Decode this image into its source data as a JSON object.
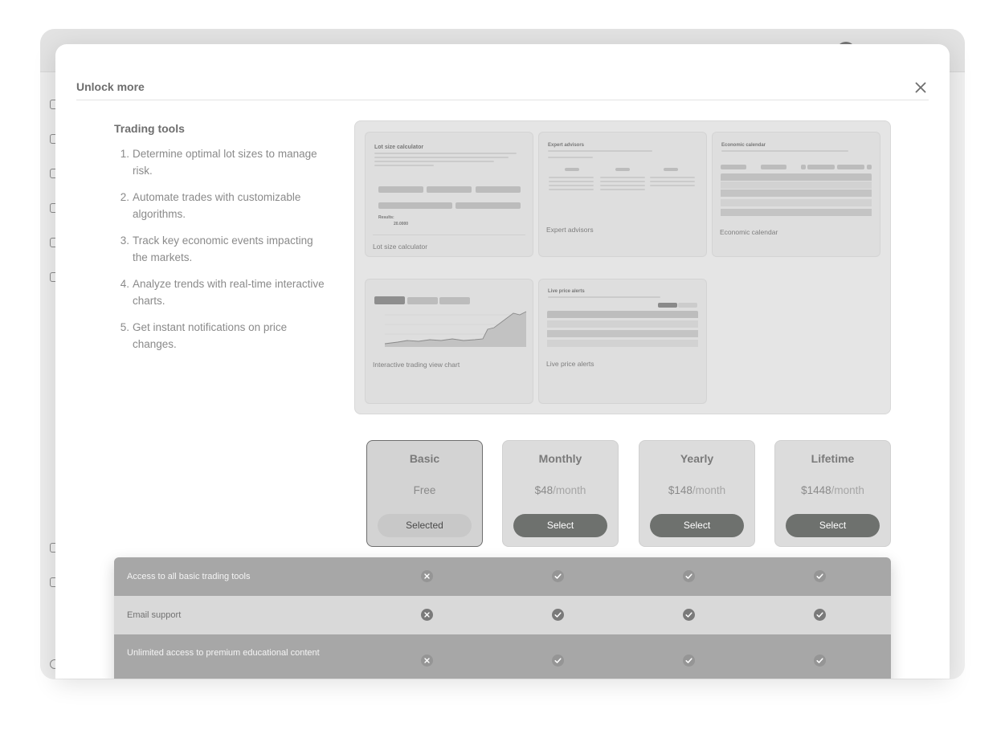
{
  "modal": {
    "title": "Unlock more"
  },
  "tools": {
    "heading": "Trading tools",
    "features": [
      {
        "num": "1.",
        "text": "Determine optimal lot sizes to manage risk."
      },
      {
        "num": "2.",
        "text": "Automate trades with customizable algorithms."
      },
      {
        "num": "3.",
        "text": "Track key economic events impacting the markets."
      },
      {
        "num": "4.",
        "text": "Analyze trends with real-time interactive charts."
      },
      {
        "num": "5.",
        "text": "Get instant notifications on price changes."
      }
    ],
    "cards": [
      {
        "label": "Lot size calculator",
        "preview_title": "Lot size calculator",
        "results": "Results:",
        "result_value": "20.0000"
      },
      {
        "label": "Expert advisors",
        "preview_title": "Expert advisors"
      },
      {
        "label": "Economic calendar",
        "preview_title": "Economic calendar"
      },
      {
        "label": "Interactive trading view chart"
      },
      {
        "label": "Live price alerts",
        "preview_title": "Live price alerts"
      }
    ]
  },
  "plans": [
    {
      "name": "Basic",
      "price": "Free",
      "unit": "",
      "button": "Selected"
    },
    {
      "name": "Monthly",
      "price": "$48",
      "unit": "/month",
      "button": "Select"
    },
    {
      "name": "Yearly",
      "price": "$148",
      "unit": "/month",
      "button": "Select"
    },
    {
      "name": "Lifetime",
      "price": "$1448",
      "unit": "/month",
      "button": "Select"
    }
  ],
  "comparison": [
    {
      "label": "Access to all basic trading tools",
      "included": [
        false,
        true,
        true,
        true
      ]
    },
    {
      "label": "Email support",
      "included": [
        false,
        true,
        true,
        true
      ]
    },
    {
      "label": "Unlimited access to premium educational content",
      "included": [
        false,
        true,
        true,
        true
      ]
    }
  ],
  "colors": {
    "button": "#6e716e",
    "panel": "#e5e5e5",
    "row_dark": "#a7a7a7",
    "row_light": "#d9d9d9"
  }
}
